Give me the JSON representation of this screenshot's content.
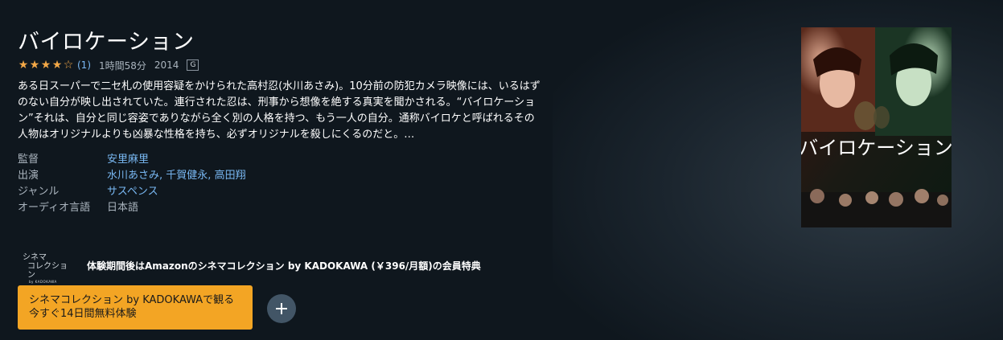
{
  "title": "バイロケーション",
  "meta": {
    "stars_filled": 4,
    "stars_total": 5,
    "rating_count": "(1)",
    "duration": "1時間58分",
    "year": "2014",
    "maturity_badge": "G"
  },
  "synopsis": "ある日スーパーで二セ札の使用容疑をかけられた高村忍(水川あさみ)。10分前の防犯カメラ映像には、いるはずのない自分が映し出されていた。連行された忍は、刑事から想像を絶する真実を聞かされる。“バイロケーション”それは、自分と同じ容姿でありながら全く別の人格を持つ、もう一人の自分。通称バイロケと呼ばれるその人物はオリジナルよりも凶暴な性格を持ち、必ずオリジナルを殺しにくるのだと。…",
  "details": {
    "director_label": "監督",
    "director": "安里麻里",
    "cast_label": "出演",
    "cast": [
      "水川あさみ",
      "千賀健永",
      "高田翔"
    ],
    "genre_label": "ジャンル",
    "genre": "サスペンス",
    "audio_label": "オーディオ言語",
    "audio": "日本語"
  },
  "poster": {
    "title_text": "バイロケーション"
  },
  "channel": {
    "logo_line1": "シネマ",
    "logo_line2": "コレクション",
    "logo_line3": "by KADOKAWA",
    "offer_text": "体験期間後はAmazonのシネマコレクション by KADOKAWA (￥396/月額)の会員特典"
  },
  "actions": {
    "watch_line1": "シネマコレクション by KADOKAWAで観る",
    "watch_line2": "今すぐ14日間無料体験",
    "add_icon": "plus-icon"
  },
  "colors": {
    "background": "#0f171e",
    "accent_button": "#f3a524",
    "link": "#79b8f3",
    "star": "#f3a847",
    "add_button": "#425566"
  }
}
